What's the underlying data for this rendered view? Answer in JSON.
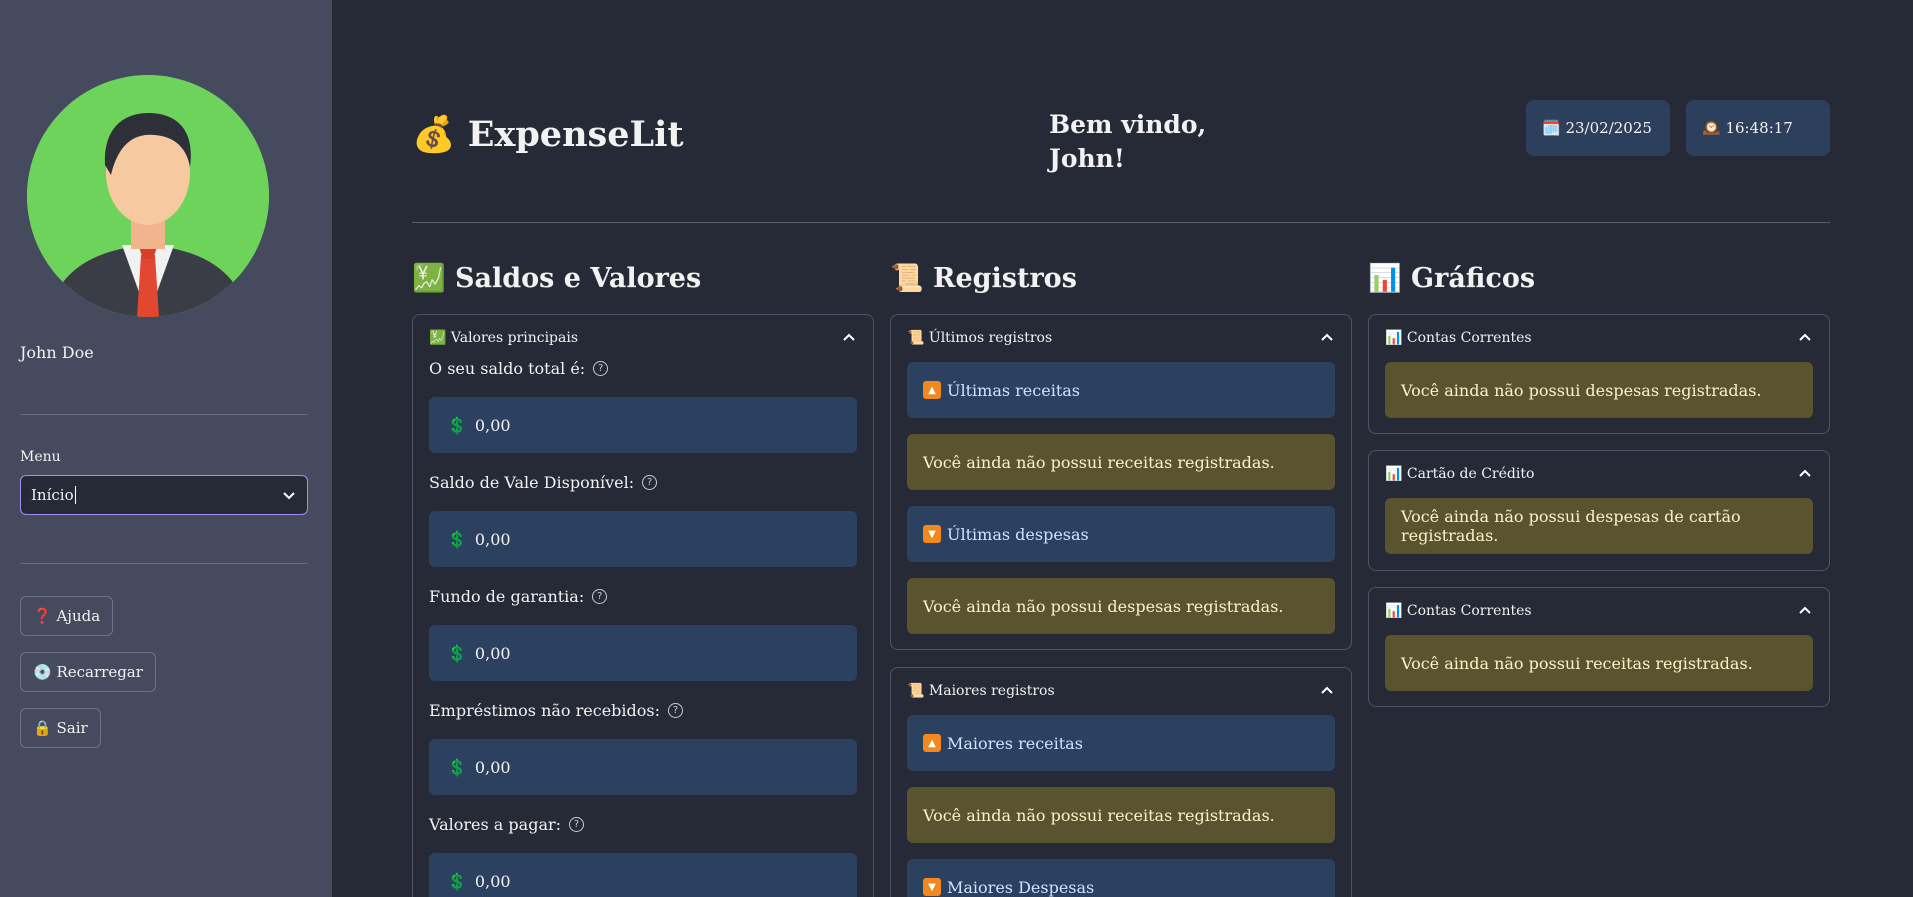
{
  "sidebar": {
    "username": "John Doe",
    "menu_label": "Menu",
    "menu_value": "Início",
    "buttons": [
      {
        "icon": "❓",
        "label": "Ajuda"
      },
      {
        "icon": "💿",
        "label": "Recarregar"
      },
      {
        "icon": "🔒",
        "label": "Sair"
      }
    ]
  },
  "header": {
    "title_icon": "💰",
    "title": "ExpenseLit",
    "welcome_line1": "Bem vindo,",
    "welcome_line2": "John!",
    "date_icon": "🗓️",
    "date": "23/02/2025",
    "time_icon": "🕰️",
    "time": "16:48:17"
  },
  "saldos": {
    "title_icon": "💹",
    "title": "Saldos e Valores",
    "panel_icon": "💹",
    "panel_title": "Valores principais",
    "currency_icon": "💲",
    "fields": [
      {
        "label": "O seu saldo total é:",
        "value": "0,00"
      },
      {
        "label": "Saldo de Vale Disponível:",
        "value": "0,00"
      },
      {
        "label": "Fundo de garantia:",
        "value": "0,00"
      },
      {
        "label": "Empréstimos não recebidos:",
        "value": "0,00"
      },
      {
        "label": "Valores a pagar:",
        "value": "0,00"
      }
    ]
  },
  "registros": {
    "title_icon": "📜",
    "title": "Registros",
    "ultimos": {
      "panel_title": "Últimos registros",
      "receitas_label": "Últimas receitas",
      "receitas_msg": "Você ainda não possui receitas registradas.",
      "despesas_label": "Últimas despesas",
      "despesas_msg": "Você ainda não possui despesas registradas."
    },
    "maiores": {
      "panel_title": "Maiores registros",
      "receitas_label": "Maiores receitas",
      "receitas_msg": "Você ainda não possui receitas registradas.",
      "despesas_label": "Maiores Despesas"
    }
  },
  "graficos": {
    "title_icon": "📊",
    "title": "Gráficos",
    "panels": [
      {
        "title": "Contas Correntes",
        "msg": "Você ainda não possui despesas registradas."
      },
      {
        "title": "Cartão de Crédito",
        "msg": "Você ainda não possui despesas de cartão registradas."
      },
      {
        "title": "Contas Correntes",
        "msg": "Você ainda não possui receitas registradas."
      }
    ]
  },
  "colors": {
    "background": "#262a36",
    "sidebar": "#454a5e",
    "info": "#2c4160",
    "warning": "#5a5330",
    "accent": "#a58cf5"
  }
}
